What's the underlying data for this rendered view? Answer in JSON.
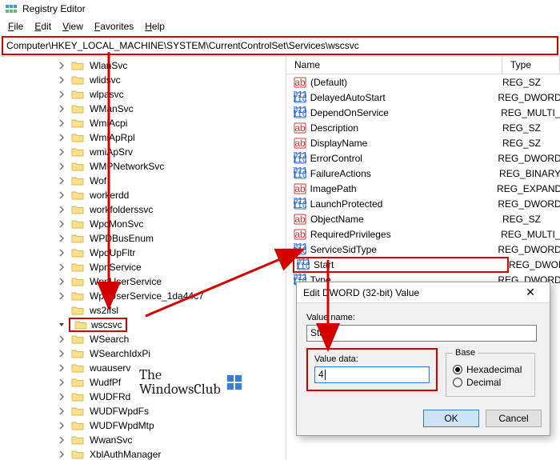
{
  "title": "Registry Editor",
  "menu": {
    "file": "File",
    "edit": "Edit",
    "view": "View",
    "favorites": "Favorites",
    "help": "Help"
  },
  "address": "Computer\\HKEY_LOCAL_MACHINE\\SYSTEM\\CurrentControlSet\\Services\\wscsvc",
  "tree": [
    {
      "label": "WlanSvc",
      "exp": ">"
    },
    {
      "label": "wlidsvc",
      "exp": ">"
    },
    {
      "label": "wlpasvc",
      "exp": ">"
    },
    {
      "label": "WManSvc",
      "exp": ">"
    },
    {
      "label": "WmiAcpi",
      "exp": ">"
    },
    {
      "label": "WmiApRpl",
      "exp": ">"
    },
    {
      "label": "wmiApSrv",
      "exp": ">"
    },
    {
      "label": "WMPNetworkSvc",
      "exp": ">"
    },
    {
      "label": "Wof",
      "exp": ">"
    },
    {
      "label": "workerdd",
      "exp": ">"
    },
    {
      "label": "workfolderssvc",
      "exp": ">"
    },
    {
      "label": "WpcMonSvc",
      "exp": ">"
    },
    {
      "label": "WPDBusEnum",
      "exp": ">"
    },
    {
      "label": "WpdUpFltr",
      "exp": ">"
    },
    {
      "label": "WpnService",
      "exp": ">"
    },
    {
      "label": "WpnUserService",
      "exp": ">"
    },
    {
      "label": "WpnUserService_1da44c7",
      "exp": ">"
    },
    {
      "label": "ws2ifsl",
      "exp": ""
    },
    {
      "label": "wscsvc",
      "exp": "v",
      "selected": true,
      "highlight": true
    },
    {
      "label": "WSearch",
      "exp": ">"
    },
    {
      "label": "WSearchIdxPi",
      "exp": ">"
    },
    {
      "label": "wuauserv",
      "exp": ">"
    },
    {
      "label": "WudfPf",
      "exp": ">"
    },
    {
      "label": "WUDFRd",
      "exp": ">"
    },
    {
      "label": "WUDFWpdFs",
      "exp": ">"
    },
    {
      "label": "WUDFWpdMtp",
      "exp": ">"
    },
    {
      "label": "WwanSvc",
      "exp": ">"
    },
    {
      "label": "XblAuthManager",
      "exp": ">"
    }
  ],
  "values_header": {
    "name": "Name",
    "type": "Type"
  },
  "values": [
    {
      "icon": "str",
      "name": "(Default)",
      "type": "REG_SZ"
    },
    {
      "icon": "dw",
      "name": "DelayedAutoStart",
      "type": "REG_DWORD"
    },
    {
      "icon": "dw",
      "name": "DependOnService",
      "type": "REG_MULTI_"
    },
    {
      "icon": "str",
      "name": "Description",
      "type": "REG_SZ"
    },
    {
      "icon": "str",
      "name": "DisplayName",
      "type": "REG_SZ"
    },
    {
      "icon": "dw",
      "name": "ErrorControl",
      "type": "REG_DWORD"
    },
    {
      "icon": "dw",
      "name": "FailureActions",
      "type": "REG_BINARY"
    },
    {
      "icon": "str",
      "name": "ImagePath",
      "type": "REG_EXPAND"
    },
    {
      "icon": "dw",
      "name": "LaunchProtected",
      "type": "REG_DWORD"
    },
    {
      "icon": "str",
      "name": "ObjectName",
      "type": "REG_SZ"
    },
    {
      "icon": "str",
      "name": "RequiredPrivileges",
      "type": "REG_MULTI_"
    },
    {
      "icon": "dw",
      "name": "ServiceSidType",
      "type": "REG_DWORD"
    },
    {
      "icon": "dw",
      "name": "Start",
      "type": "REG_DWORD",
      "highlight": true
    },
    {
      "icon": "dw",
      "name": "Type",
      "type": "REG_DWORD"
    }
  ],
  "dialog": {
    "title": "Edit DWORD (32-bit) Value",
    "value_name_label": "Value name:",
    "value_name": "Start",
    "value_data_label": "Value data:",
    "value_data": "4",
    "base_label": "Base",
    "radio_hex": "Hexadecimal",
    "radio_dec": "Decimal",
    "ok": "OK",
    "cancel": "Cancel"
  },
  "watermark": {
    "line1": "The",
    "line2": "WindowsClub"
  }
}
